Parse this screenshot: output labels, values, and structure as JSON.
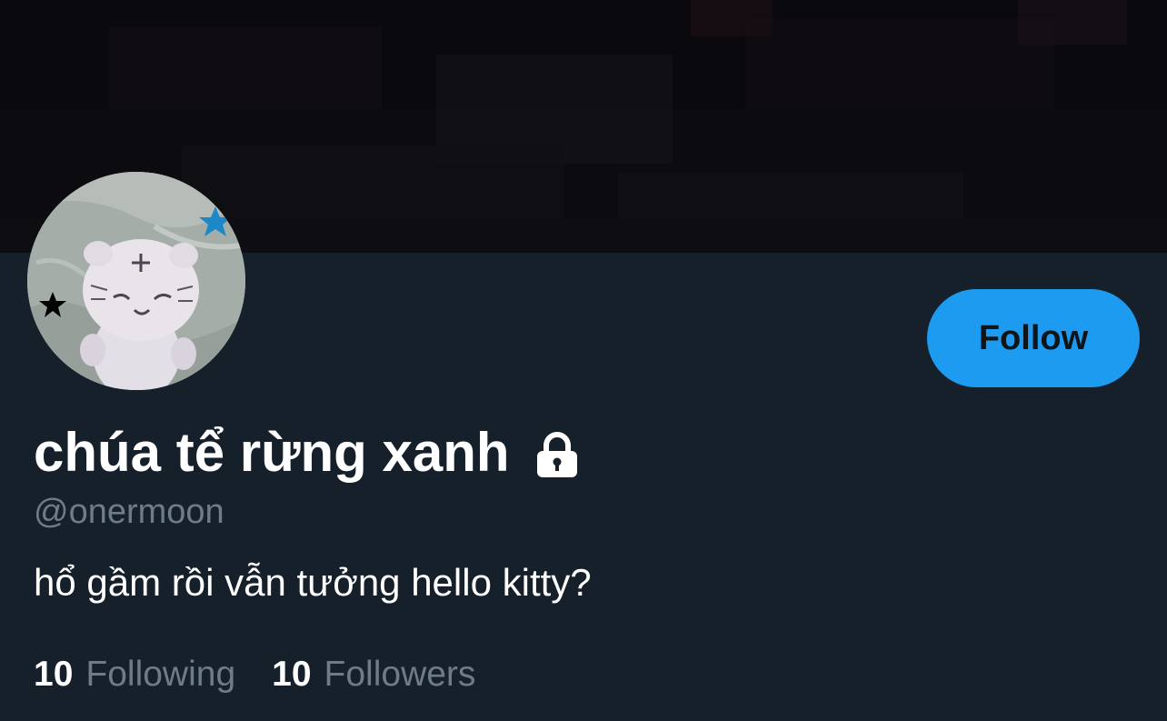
{
  "profile": {
    "display_name": "chúa tể rừng xanh",
    "handle": "@onermoon",
    "bio": "hổ gầm rồi vẫn tưởng hello kitty?",
    "protected_icon": "lock-icon",
    "avatar_description_icon": "avatar-image"
  },
  "actions": {
    "follow_label": "Follow"
  },
  "stats": {
    "following_count": "10",
    "following_label": "Following",
    "followers_count": "10",
    "followers_label": "Followers"
  },
  "colors": {
    "background": "#15202b",
    "banner": "#0d0c10",
    "accent": "#1d9bf0",
    "text_primary": "#ffffff",
    "text_secondary": "#6e7b88",
    "avatar_star_blue": "#1d88c8"
  }
}
